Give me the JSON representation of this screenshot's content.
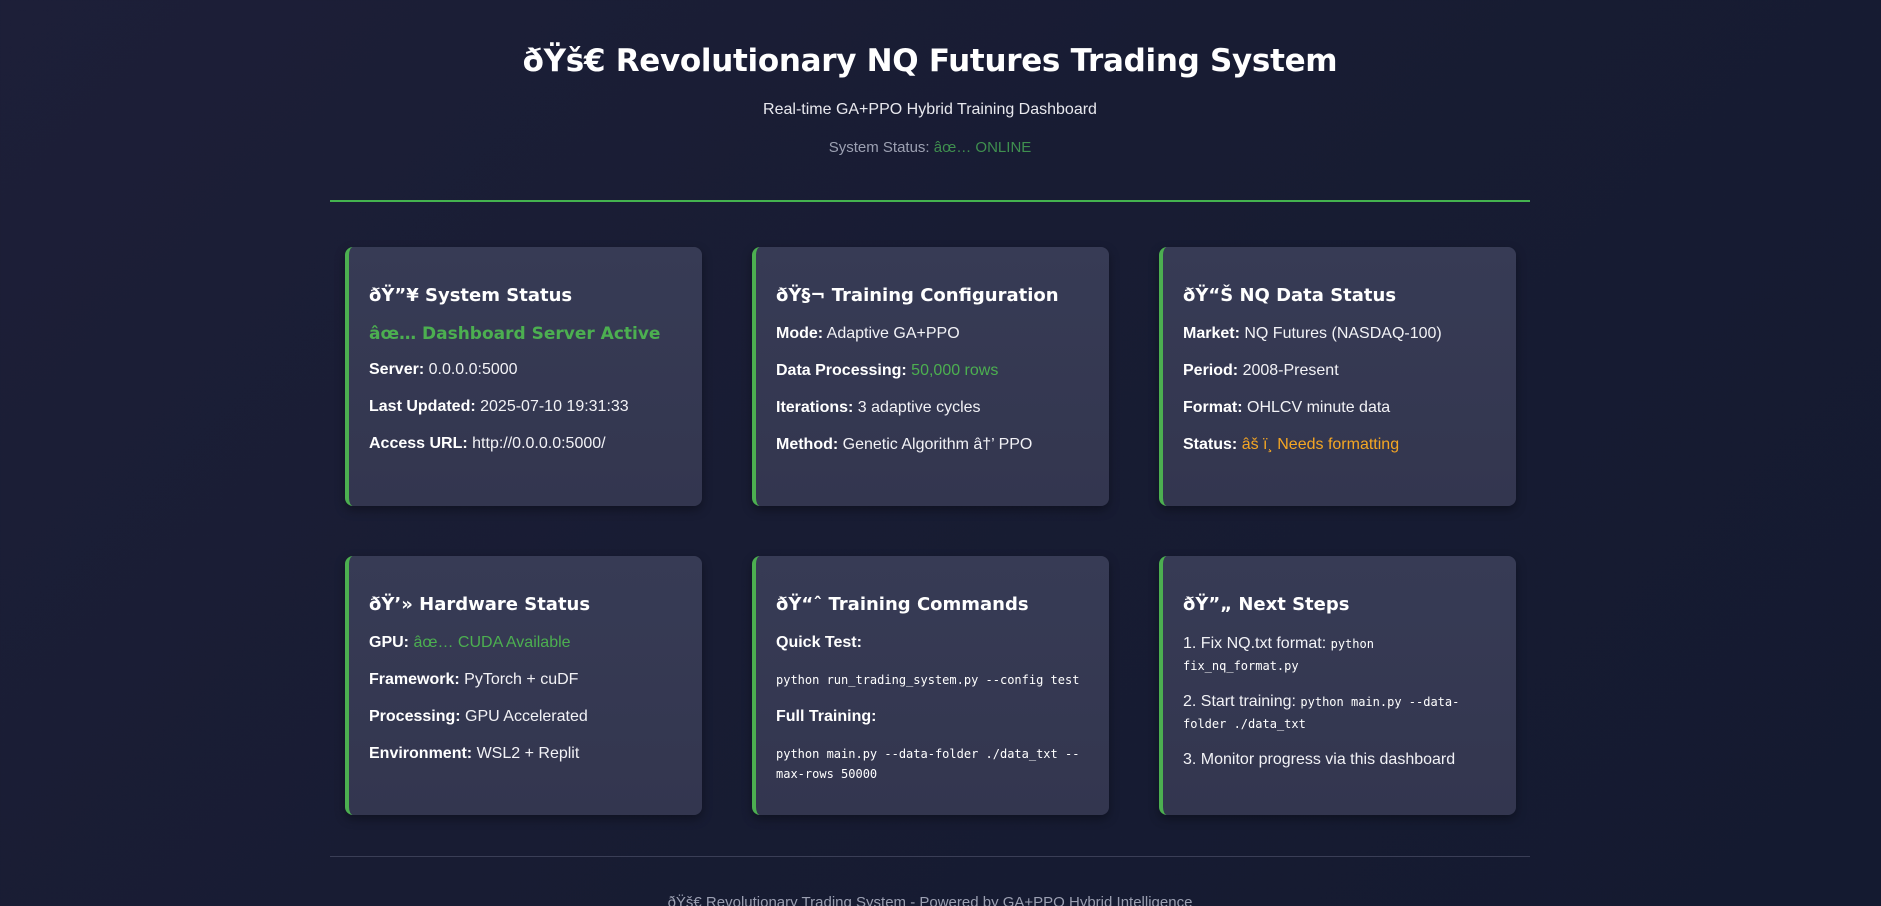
{
  "header": {
    "title": "ðŸš€ Revolutionary NQ Futures Trading System",
    "subtitle": "Real-time GA+PPO Hybrid Training Dashboard",
    "status_label": "System Status:",
    "status_value": "âœ… ONLINE"
  },
  "cards": {
    "system_status": {
      "title": "ðŸ”¥ System Status",
      "highlight": "âœ… Dashboard Server Active",
      "rows": [
        {
          "label": "Server:",
          "value": "0.0.0.0:5000"
        },
        {
          "label": "Last Updated:",
          "value": "2025-07-10 19:31:33"
        },
        {
          "label": "Access URL:",
          "value": "http://0.0.0.0:5000/"
        }
      ]
    },
    "training_config": {
      "title": "ðŸ§¬ Training Configuration",
      "rows": [
        {
          "label": "Mode:",
          "value": "Adaptive GA+PPO"
        },
        {
          "label": "Data Processing:",
          "value": "50,000 rows"
        },
        {
          "label": "Iterations:",
          "value": "3 adaptive cycles"
        },
        {
          "label": "Method:",
          "value": "Genetic Algorithm â†’ PPO"
        }
      ]
    },
    "nq_data": {
      "title": "ðŸ“Š NQ Data Status",
      "rows": [
        {
          "label": "Market:",
          "value": "NQ Futures (NASDAQ-100)"
        },
        {
          "label": "Period:",
          "value": "2008-Present"
        },
        {
          "label": "Format:",
          "value": "OHLCV minute data"
        },
        {
          "label": "Status:",
          "value": "âš ï¸ Needs formatting"
        }
      ]
    },
    "hardware": {
      "title": "ðŸ’» Hardware Status",
      "rows": [
        {
          "label": "GPU:",
          "value": "âœ… CUDA Available"
        },
        {
          "label": "Framework:",
          "value": "PyTorch + cuDF"
        },
        {
          "label": "Processing:",
          "value": "GPU Accelerated"
        },
        {
          "label": "Environment:",
          "value": "WSL2 + Replit"
        }
      ]
    },
    "commands": {
      "title": "ðŸ“ˆ Training Commands",
      "quick_label": "Quick Test:",
      "quick_cmd": "python run_trading_system.py --config test",
      "full_label": "Full Training:",
      "full_cmd_line1": "python main.py --data-folder ./data_txt --",
      "full_cmd_line2": "max-rows 50000"
    },
    "next_steps": {
      "title": "ðŸ”„ Next Steps",
      "step1_text": "1. Fix NQ.txt format:",
      "step1_code": "python fix_nq_format.py",
      "step2_text": "2. Start training:",
      "step2_code_line1": "python main.py --data-",
      "step2_code_line2": "folder ./data_txt",
      "step3_text": "3. Monitor progress via this dashboard"
    }
  },
  "footer": {
    "text": "ðŸš€ Revolutionary Trading System - Powered by GA+PPO Hybrid Intelligence"
  },
  "colors": {
    "accent_green": "#4caf50",
    "warning_orange": "#f5a623",
    "card_bg": "#363a54",
    "page_bg": "#1a1d35"
  }
}
